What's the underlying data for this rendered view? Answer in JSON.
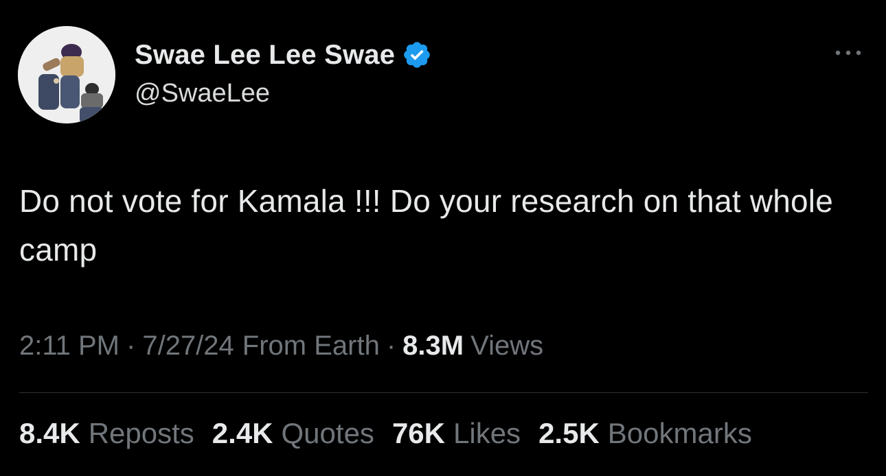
{
  "author": {
    "display_name": "Swae Lee Lee Swae",
    "handle": "@SwaeLee",
    "verified_color": "#1d9bf0",
    "avatar_icon": "profile-photo",
    "verified_icon": "verified-badge-icon"
  },
  "more_icon": "more-dots-icon",
  "tweet": {
    "text": "Do not vote for Kamala !!! Do your research on that whole camp"
  },
  "meta": {
    "time": "2:11 PM",
    "separator": "·",
    "date": "7/27/24",
    "location": "From Earth",
    "views_count": "8.3M",
    "views_label": "Views"
  },
  "stats": [
    {
      "count": "8.4K",
      "label": "Reposts"
    },
    {
      "count": "2.4K",
      "label": "Quotes"
    },
    {
      "count": "76K",
      "label": "Likes"
    },
    {
      "count": "2.5K",
      "label": "Bookmarks"
    }
  ],
  "colors": {
    "background": "#000000",
    "primary_text": "#e7e9ea",
    "secondary_text": "#71767b",
    "divider": "#2f3336"
  }
}
